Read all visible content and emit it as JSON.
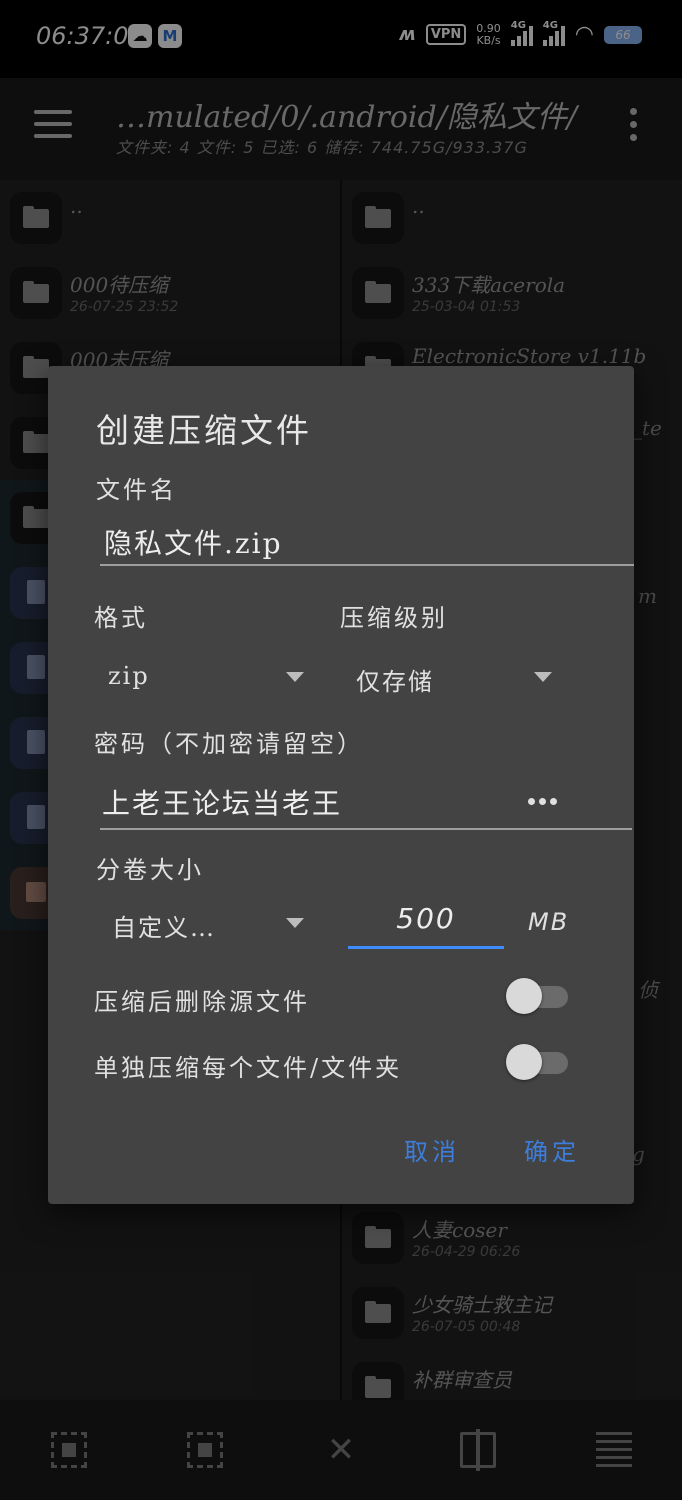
{
  "status_bar": {
    "time": "06:37:01",
    "vpn": "VPN",
    "speed_value": "0.90",
    "speed_unit": "KB/s",
    "signal1": "4G",
    "signal2": "4G",
    "battery": "66"
  },
  "toolbar": {
    "path": "…mulated/0/.android/隐私文件/",
    "stats": "文件夹: 4  文件: 5  已选: 6  储存: 744.75G/933.37G"
  },
  "left_pane": {
    "items": [
      {
        "name": "..",
        "date": ""
      },
      {
        "name": "000待压缩",
        "date": "26-07-25 23:52"
      },
      {
        "name": "000未压缩",
        "date": ""
      }
    ]
  },
  "right_pane": {
    "items": [
      {
        "name": "..",
        "date": ""
      },
      {
        "name": "333下载acerola",
        "date": "25-03-04 01:53"
      },
      {
        "name": "ElectronicStore v1.11b",
        "date": ""
      }
    ],
    "bottom_items": [
      {
        "name": "人妻coser",
        "date": "26-04-29 06:26"
      },
      {
        "name": "少女骑士救主记",
        "date": "26-07-05 00:48"
      },
      {
        "name": "补群审查员",
        "date": ""
      }
    ],
    "partial_texts": [
      "_te",
      "m",
      "侦",
      "g"
    ]
  },
  "dialog": {
    "title": "创建压缩文件",
    "filename_label": "文件名",
    "filename_value": "隐私文件.zip",
    "format_label": "格式",
    "format_value": "zip",
    "level_label": "压缩级别",
    "level_value": "仅存储",
    "password_label": "密码（不加密请留空）",
    "password_value": "上老王论坛当老王",
    "volume_label": "分卷大小",
    "volume_mode": "自定义…",
    "volume_size": "500",
    "volume_unit": "MB",
    "delete_source_label": "压缩后删除源文件",
    "delete_source_on": false,
    "separate_label": "单独压缩每个文件/文件夹",
    "separate_on": false,
    "cancel": "取消",
    "ok": "确定"
  }
}
